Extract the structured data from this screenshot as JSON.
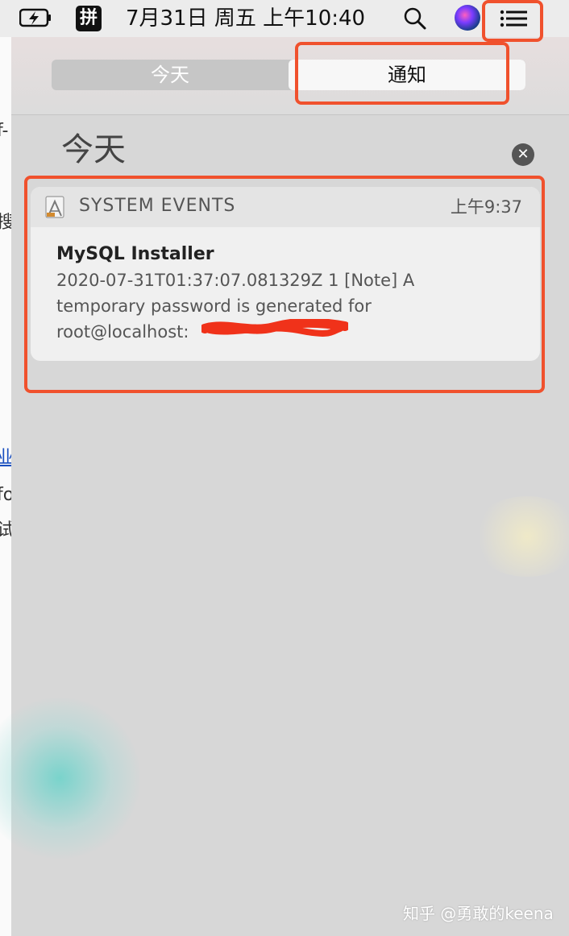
{
  "menubar": {
    "ime_label": "拼",
    "clock": "7月31日 周五 上午10:40",
    "icons": [
      "battery-charging-icon",
      "input-method-icon",
      "search-icon",
      "siri-icon",
      "notification-center-icon"
    ]
  },
  "notification_center": {
    "tabs": [
      {
        "label": "今天",
        "active": false
      },
      {
        "label": "通知",
        "active": true
      }
    ],
    "section_title": "今天",
    "clear_label": "✕",
    "notifications": [
      {
        "app_name": "SYSTEM EVENTS",
        "time": "上午9:37",
        "title": "MySQL Installer",
        "body": "2020-07-31T01:37:07.081329Z 1 [Note] A temporary password is generated for root@localhost:"
      }
    ]
  },
  "background_window": {
    "fragments": [
      "f-",
      "搜",
      "业",
      "fo",
      "试"
    ]
  },
  "watermark": "知乎 @勇敢的keena",
  "colors": {
    "highlight": "#f0512d",
    "panel_bg": "#d7d7d7",
    "card_bg": "#f0f0f0"
  }
}
